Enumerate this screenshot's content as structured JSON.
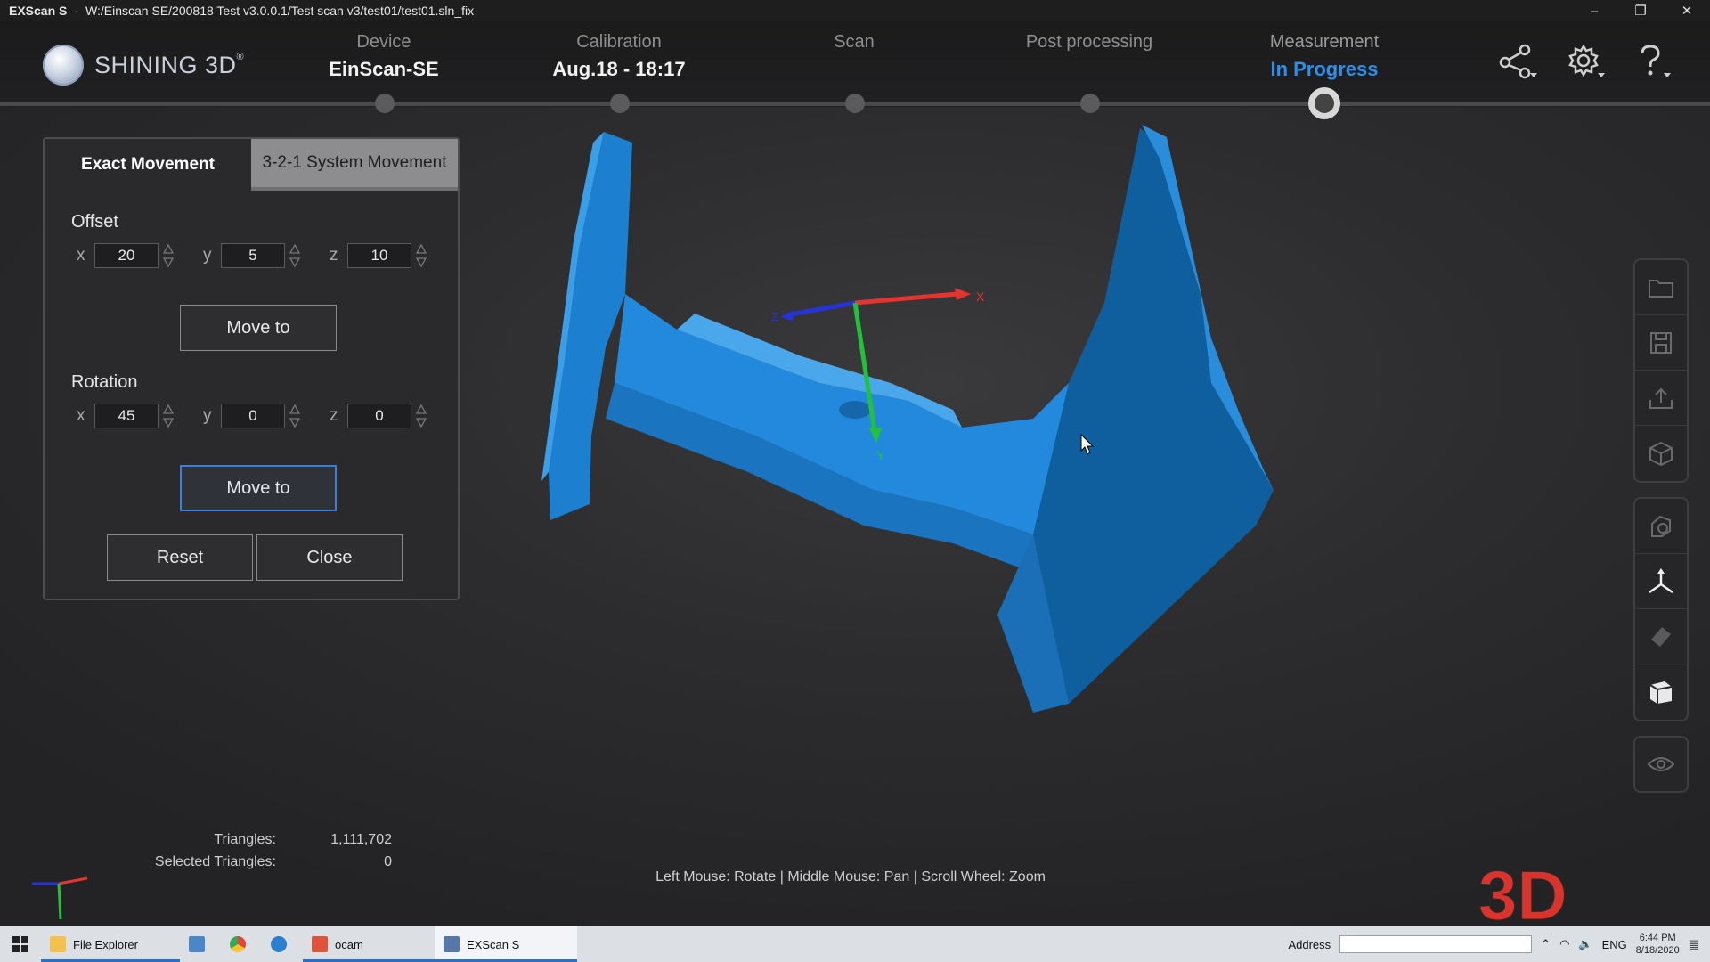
{
  "window": {
    "app_name": "EXScan S",
    "separator": "-",
    "path": "W:/Einscan SE/200818 Test v3.0.0.1/Test scan v3/test01/test01.sln_fix",
    "controls": {
      "minimize": "–",
      "restore": "❐",
      "close": "✕"
    }
  },
  "header": {
    "logo_text": "SHINING 3D",
    "logo_reg": "®",
    "steps": [
      {
        "label": "Device",
        "value": "EinScan-SE"
      },
      {
        "label": "Calibration",
        "value": "Aug.18 - 18:17"
      },
      {
        "label": "Scan",
        "value": ""
      },
      {
        "label": "Post processing",
        "value": ""
      },
      {
        "label": "Measurement",
        "value": "In Progress",
        "active": true
      }
    ],
    "icons": [
      "share-icon",
      "settings-icon",
      "help-icon"
    ]
  },
  "panel": {
    "tabs": [
      "Exact Movement",
      "3-2-1 System  Movement"
    ],
    "offset": {
      "title": "Offset",
      "x": "20",
      "y": "5",
      "z": "10",
      "button": "Move to"
    },
    "rotation": {
      "title": "Rotation",
      "x": "45",
      "y": "0",
      "z": "0",
      "button": "Move to"
    },
    "reset": "Reset",
    "close": "Close",
    "axis_labels": {
      "x": "x",
      "y": "y",
      "z": "z"
    }
  },
  "viewport": {
    "gizmo_labels": {
      "x": "X",
      "y": "Y",
      "z": "Z"
    },
    "model_color": "#1f86d8",
    "hint": "Left Mouse: Rotate | Middle Mouse: Pan | Scroll Wheel: Zoom",
    "stats": {
      "triangles_label": "Triangles:",
      "triangles_value": "1,111,702",
      "selected_label": "Selected Triangles:",
      "selected_value": "0"
    },
    "watermark": "3D"
  },
  "toolbar": {
    "group1": [
      "folder-icon",
      "save-icon",
      "export-icon",
      "cube-icon"
    ],
    "group2": [
      "align-icon",
      "coordinate-axes-icon",
      "measure-icon",
      "box-select-icon"
    ],
    "group3": [
      "eye-icon"
    ]
  },
  "taskbar": {
    "items": [
      "File Explorer",
      "",
      "",
      "",
      "ocam",
      "EXScan S"
    ],
    "address_label": "Address",
    "language": "ENG",
    "time": "6:44 PM",
    "date": "8/18/2020"
  },
  "colors": {
    "accent": "#2f8fe6",
    "axis_x": "#e3342f",
    "axis_y": "#22c13a",
    "axis_z": "#1f3fd6"
  }
}
